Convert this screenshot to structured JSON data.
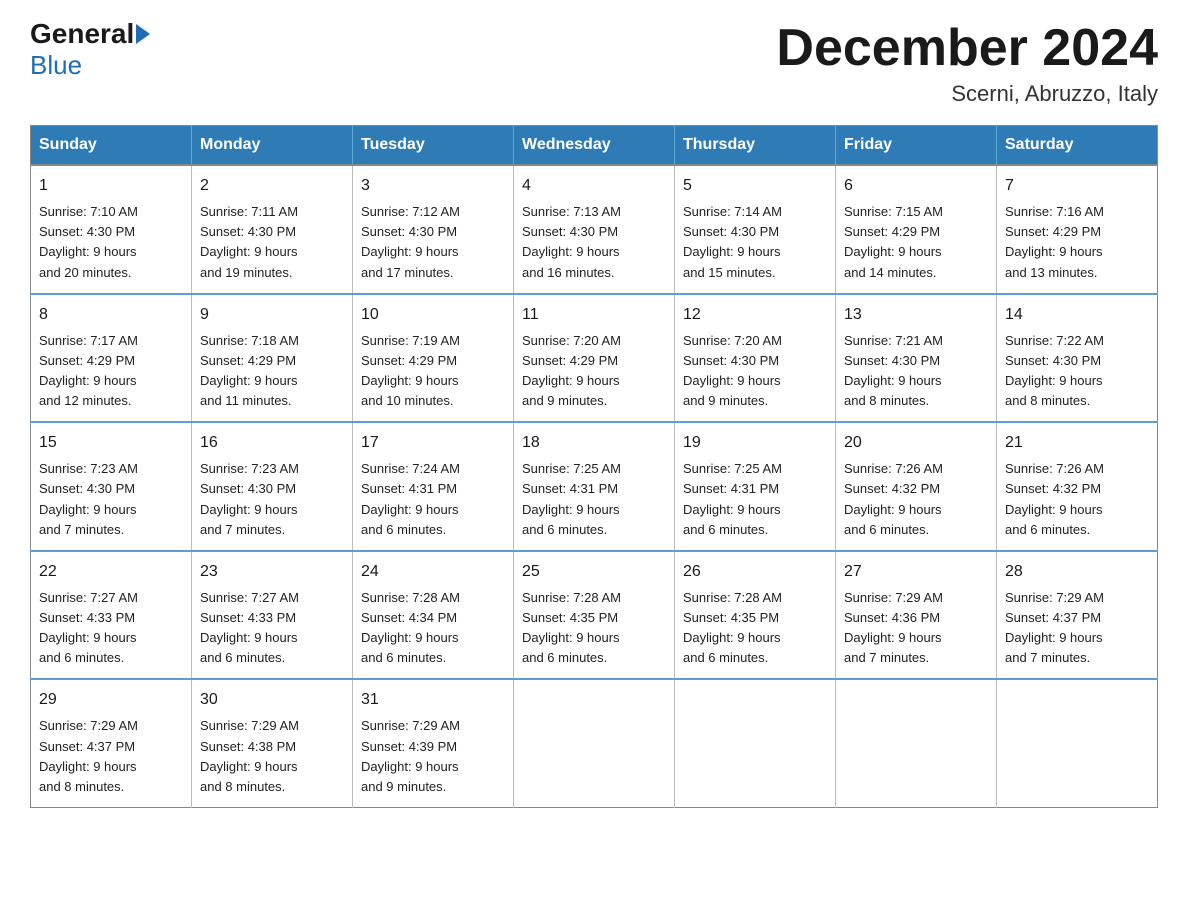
{
  "header": {
    "logo_general": "General",
    "logo_blue": "Blue",
    "title": "December 2024",
    "location": "Scerni, Abruzzo, Italy"
  },
  "weekdays": [
    "Sunday",
    "Monday",
    "Tuesday",
    "Wednesday",
    "Thursday",
    "Friday",
    "Saturday"
  ],
  "weeks": [
    [
      {
        "day": "1",
        "sunrise": "7:10 AM",
        "sunset": "4:30 PM",
        "daylight": "9 hours and 20 minutes."
      },
      {
        "day": "2",
        "sunrise": "7:11 AM",
        "sunset": "4:30 PM",
        "daylight": "9 hours and 19 minutes."
      },
      {
        "day": "3",
        "sunrise": "7:12 AM",
        "sunset": "4:30 PM",
        "daylight": "9 hours and 17 minutes."
      },
      {
        "day": "4",
        "sunrise": "7:13 AM",
        "sunset": "4:30 PM",
        "daylight": "9 hours and 16 minutes."
      },
      {
        "day": "5",
        "sunrise": "7:14 AM",
        "sunset": "4:30 PM",
        "daylight": "9 hours and 15 minutes."
      },
      {
        "day": "6",
        "sunrise": "7:15 AM",
        "sunset": "4:29 PM",
        "daylight": "9 hours and 14 minutes."
      },
      {
        "day": "7",
        "sunrise": "7:16 AM",
        "sunset": "4:29 PM",
        "daylight": "9 hours and 13 minutes."
      }
    ],
    [
      {
        "day": "8",
        "sunrise": "7:17 AM",
        "sunset": "4:29 PM",
        "daylight": "9 hours and 12 minutes."
      },
      {
        "day": "9",
        "sunrise": "7:18 AM",
        "sunset": "4:29 PM",
        "daylight": "9 hours and 11 minutes."
      },
      {
        "day": "10",
        "sunrise": "7:19 AM",
        "sunset": "4:29 PM",
        "daylight": "9 hours and 10 minutes."
      },
      {
        "day": "11",
        "sunrise": "7:20 AM",
        "sunset": "4:29 PM",
        "daylight": "9 hours and 9 minutes."
      },
      {
        "day": "12",
        "sunrise": "7:20 AM",
        "sunset": "4:30 PM",
        "daylight": "9 hours and 9 minutes."
      },
      {
        "day": "13",
        "sunrise": "7:21 AM",
        "sunset": "4:30 PM",
        "daylight": "9 hours and 8 minutes."
      },
      {
        "day": "14",
        "sunrise": "7:22 AM",
        "sunset": "4:30 PM",
        "daylight": "9 hours and 8 minutes."
      }
    ],
    [
      {
        "day": "15",
        "sunrise": "7:23 AM",
        "sunset": "4:30 PM",
        "daylight": "9 hours and 7 minutes."
      },
      {
        "day": "16",
        "sunrise": "7:23 AM",
        "sunset": "4:30 PM",
        "daylight": "9 hours and 7 minutes."
      },
      {
        "day": "17",
        "sunrise": "7:24 AM",
        "sunset": "4:31 PM",
        "daylight": "9 hours and 6 minutes."
      },
      {
        "day": "18",
        "sunrise": "7:25 AM",
        "sunset": "4:31 PM",
        "daylight": "9 hours and 6 minutes."
      },
      {
        "day": "19",
        "sunrise": "7:25 AM",
        "sunset": "4:31 PM",
        "daylight": "9 hours and 6 minutes."
      },
      {
        "day": "20",
        "sunrise": "7:26 AM",
        "sunset": "4:32 PM",
        "daylight": "9 hours and 6 minutes."
      },
      {
        "day": "21",
        "sunrise": "7:26 AM",
        "sunset": "4:32 PM",
        "daylight": "9 hours and 6 minutes."
      }
    ],
    [
      {
        "day": "22",
        "sunrise": "7:27 AM",
        "sunset": "4:33 PM",
        "daylight": "9 hours and 6 minutes."
      },
      {
        "day": "23",
        "sunrise": "7:27 AM",
        "sunset": "4:33 PM",
        "daylight": "9 hours and 6 minutes."
      },
      {
        "day": "24",
        "sunrise": "7:28 AM",
        "sunset": "4:34 PM",
        "daylight": "9 hours and 6 minutes."
      },
      {
        "day": "25",
        "sunrise": "7:28 AM",
        "sunset": "4:35 PM",
        "daylight": "9 hours and 6 minutes."
      },
      {
        "day": "26",
        "sunrise": "7:28 AM",
        "sunset": "4:35 PM",
        "daylight": "9 hours and 6 minutes."
      },
      {
        "day": "27",
        "sunrise": "7:29 AM",
        "sunset": "4:36 PM",
        "daylight": "9 hours and 7 minutes."
      },
      {
        "day": "28",
        "sunrise": "7:29 AM",
        "sunset": "4:37 PM",
        "daylight": "9 hours and 7 minutes."
      }
    ],
    [
      {
        "day": "29",
        "sunrise": "7:29 AM",
        "sunset": "4:37 PM",
        "daylight": "9 hours and 8 minutes."
      },
      {
        "day": "30",
        "sunrise": "7:29 AM",
        "sunset": "4:38 PM",
        "daylight": "9 hours and 8 minutes."
      },
      {
        "day": "31",
        "sunrise": "7:29 AM",
        "sunset": "4:39 PM",
        "daylight": "9 hours and 9 minutes."
      },
      null,
      null,
      null,
      null
    ]
  ],
  "labels": {
    "sunrise": "Sunrise:",
    "sunset": "Sunset:",
    "daylight": "Daylight:"
  }
}
